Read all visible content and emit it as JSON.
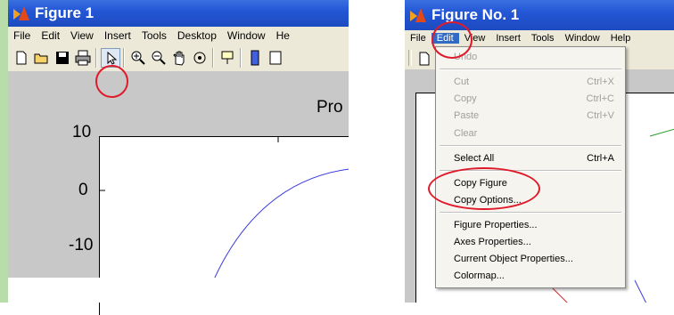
{
  "left_window": {
    "title": "Figure 1",
    "menu": [
      "File",
      "Edit",
      "View",
      "Insert",
      "Tools",
      "Desktop",
      "Window",
      "He"
    ],
    "toolbar_icons": [
      "new-figure-icon",
      "open-file-icon",
      "save-icon",
      "print-icon",
      "select-arrow-icon",
      "zoom-in-icon",
      "zoom-out-icon",
      "pan-hand-icon",
      "rotate-3d-icon",
      "data-cursor-icon",
      "colorbar-icon"
    ],
    "plot": {
      "title": "Pro",
      "yticks": [
        "10",
        "0",
        "-10"
      ]
    },
    "highlight": "print-icon"
  },
  "right_window": {
    "title": "Figure No. 1",
    "menu": [
      "File",
      "Edit",
      "View",
      "Insert",
      "Tools",
      "Window",
      "Help"
    ],
    "active_menu": "Edit",
    "edit_menu": {
      "items": [
        {
          "label": "Undo",
          "shortcut": "",
          "disabled": true
        },
        {
          "label": "Cut",
          "shortcut": "Ctrl+X",
          "disabled": true
        },
        {
          "label": "Copy",
          "shortcut": "Ctrl+C",
          "disabled": true
        },
        {
          "label": "Paste",
          "shortcut": "Ctrl+V",
          "disabled": true
        },
        {
          "label": "Clear",
          "shortcut": "",
          "disabled": true
        },
        {
          "label": "Select All",
          "shortcut": "Ctrl+A",
          "disabled": false
        },
        {
          "label": "Copy Figure",
          "shortcut": "",
          "disabled": false
        },
        {
          "label": "Copy Options...",
          "shortcut": "",
          "disabled": false
        },
        {
          "label": "Figure Properties...",
          "shortcut": "",
          "disabled": false
        },
        {
          "label": "Axes Properties...",
          "shortcut": "",
          "disabled": false
        },
        {
          "label": "Current Object Properties...",
          "shortcut": "",
          "disabled": false
        },
        {
          "label": "Colormap...",
          "shortcut": "",
          "disabled": false
        }
      ]
    }
  },
  "colors": {
    "titlebar": "#2457d6",
    "highlight_ellipse": "#e01a2a",
    "menu_active": "#316ac5",
    "disabled_text": "#a0a0a0",
    "plot_line": "#3a3adf"
  }
}
